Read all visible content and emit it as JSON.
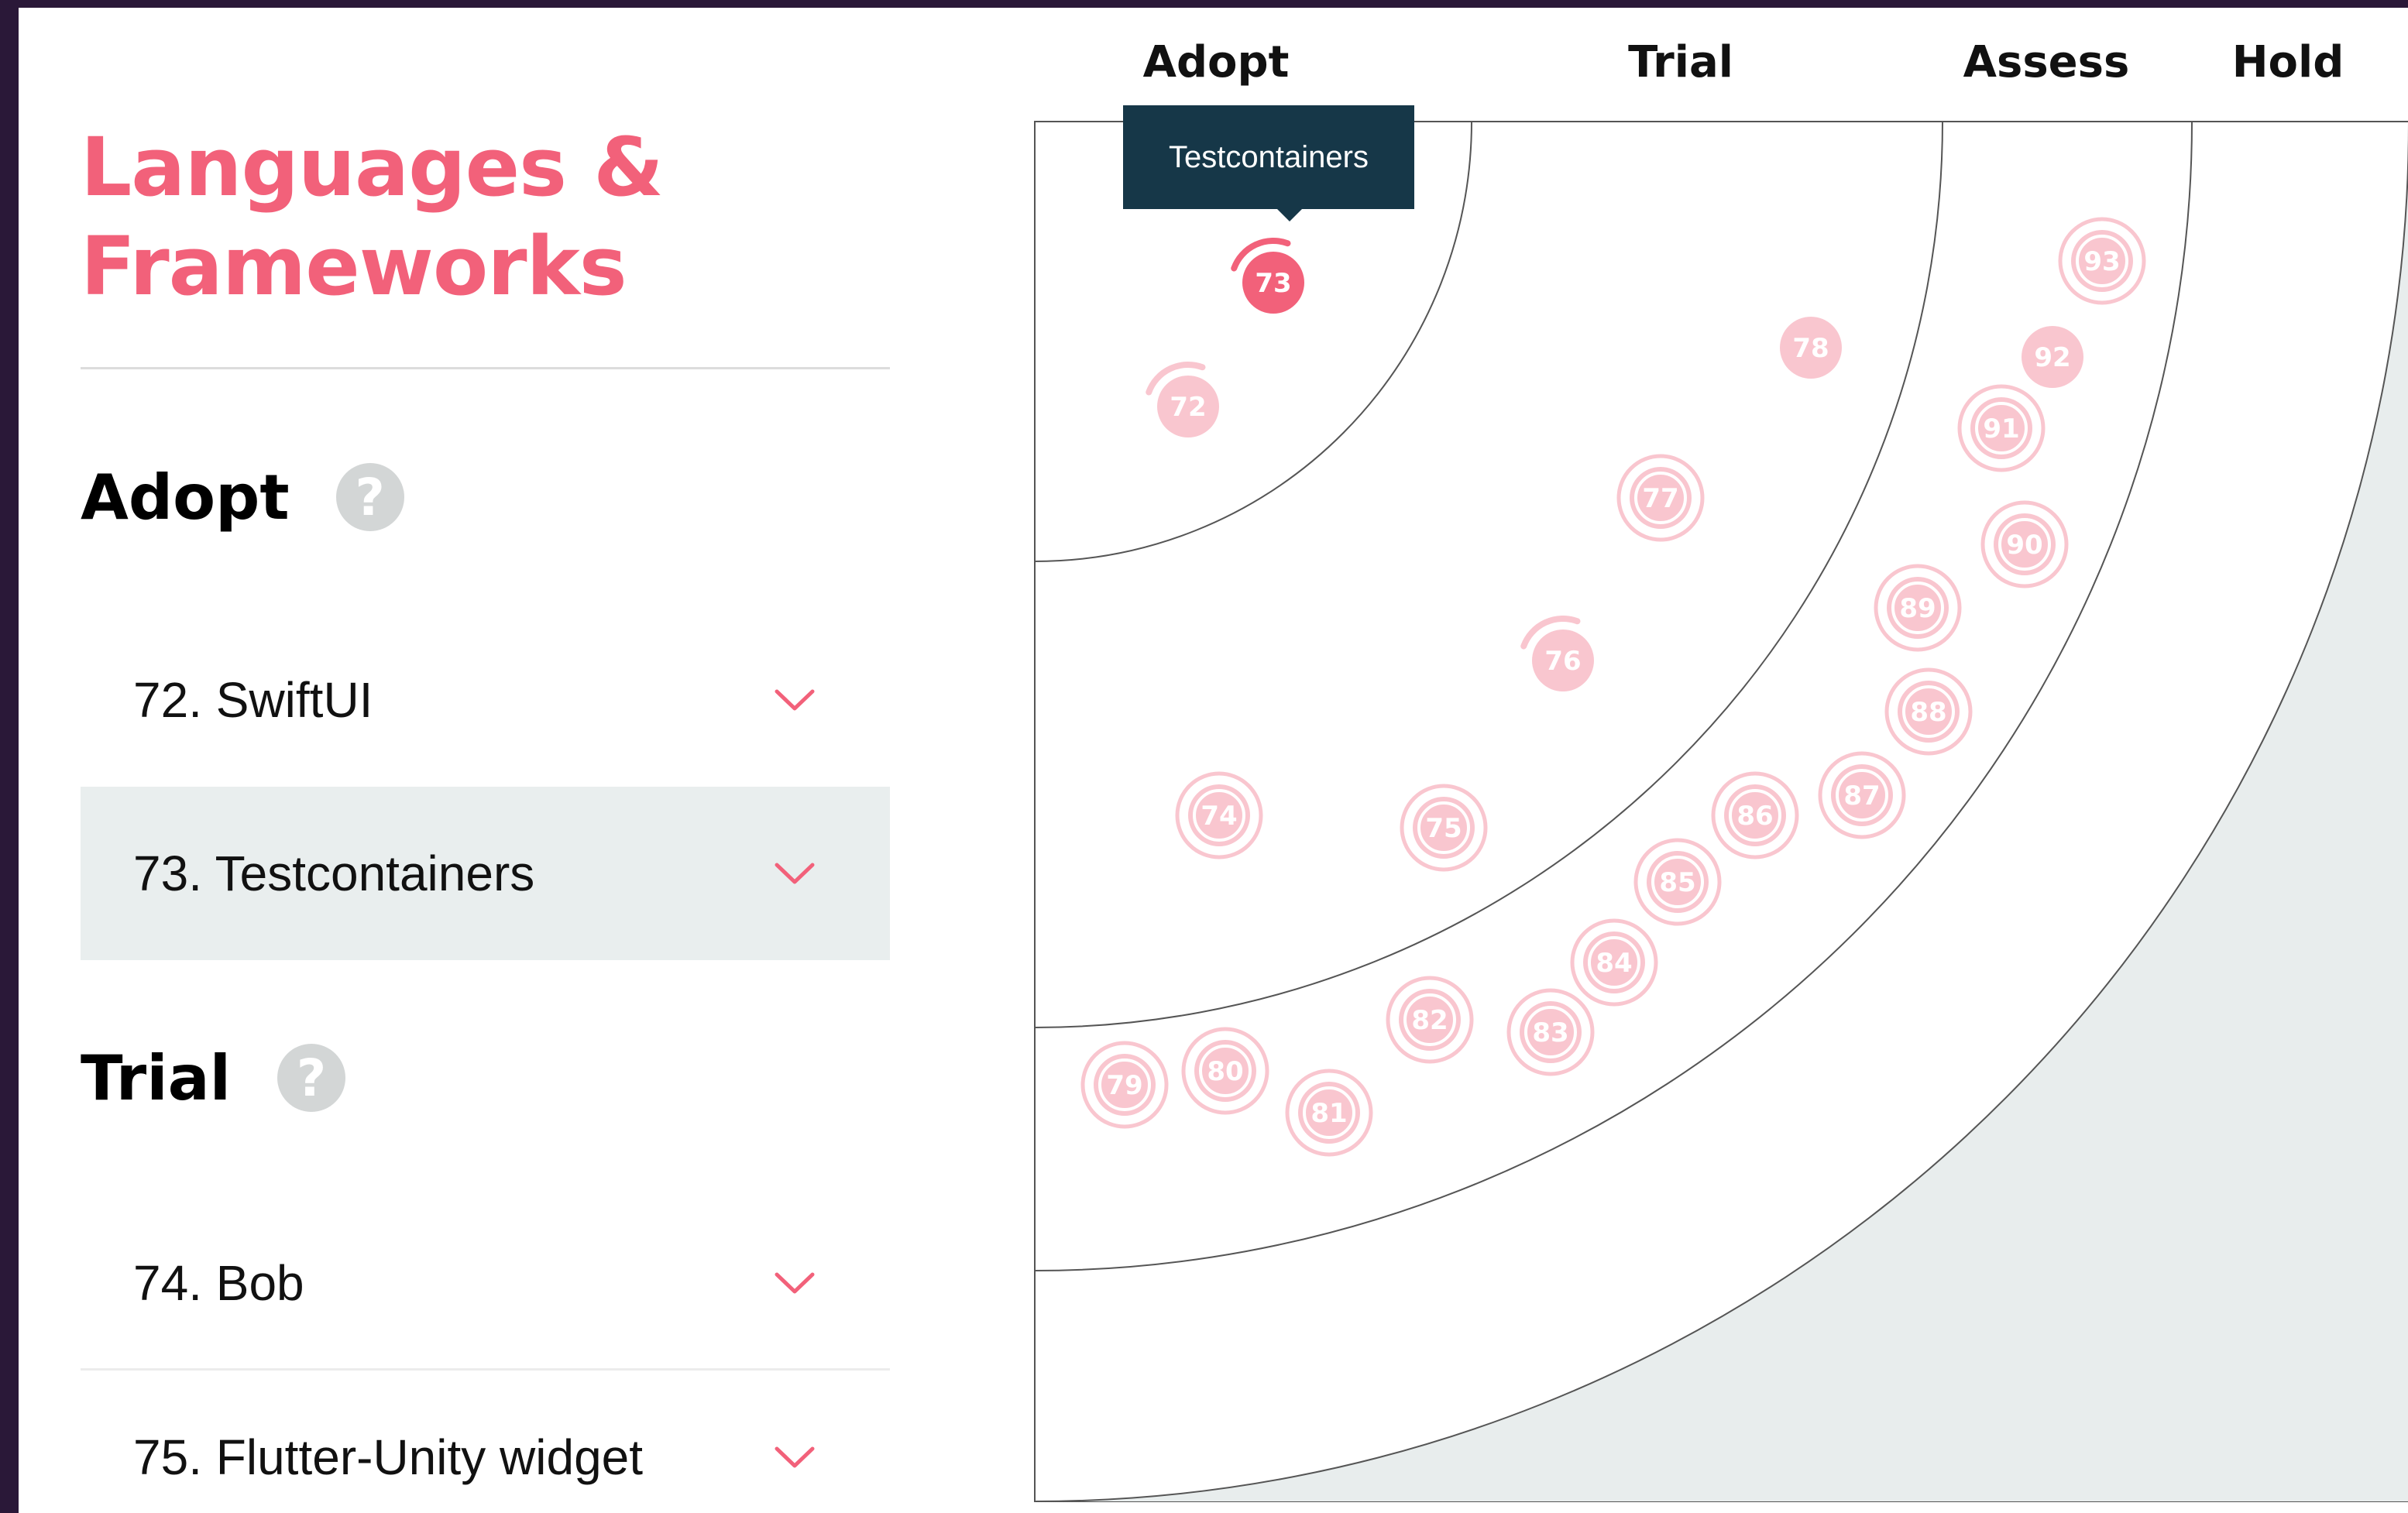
{
  "quadrant": {
    "title": "Languages &\nFrameworks"
  },
  "rings": [
    "Adopt",
    "Trial",
    "Assess",
    "Hold"
  ],
  "list": {
    "headings": [
      {
        "label": "Adopt",
        "help_icon": "question-mark-icon"
      },
      {
        "label": "Trial",
        "help_icon": "question-mark-icon"
      }
    ],
    "items": [
      {
        "label": "72. SwiftUI",
        "ring": "Adopt",
        "selected": false
      },
      {
        "label": "73. Testcontainers",
        "ring": "Adopt",
        "selected": true
      },
      {
        "label": "74. Bob",
        "ring": "Trial",
        "selected": false
      },
      {
        "label": "75. Flutter-Unity widget",
        "ring": "Trial",
        "selected": false
      }
    ],
    "expand_icon": "chevron-down-icon"
  },
  "tooltip": {
    "text": "Testcontainers"
  },
  "blips": [
    {
      "id": "72",
      "ring": "Adopt",
      "style": "new",
      "active": false
    },
    {
      "id": "73",
      "ring": "Adopt",
      "style": "new",
      "active": true
    },
    {
      "id": "74",
      "ring": "Trial",
      "style": "unchanged",
      "active": false
    },
    {
      "id": "75",
      "ring": "Trial",
      "style": "unchanged",
      "active": false
    },
    {
      "id": "76",
      "ring": "Trial",
      "style": "new",
      "active": false
    },
    {
      "id": "77",
      "ring": "Trial",
      "style": "unchanged",
      "active": false
    },
    {
      "id": "78",
      "ring": "Trial",
      "style": "plain",
      "active": false
    },
    {
      "id": "79",
      "ring": "Assess",
      "style": "unchanged",
      "active": false
    },
    {
      "id": "80",
      "ring": "Assess",
      "style": "unchanged",
      "active": false
    },
    {
      "id": "81",
      "ring": "Assess",
      "style": "unchanged",
      "active": false
    },
    {
      "id": "82",
      "ring": "Assess",
      "style": "unchanged",
      "active": false
    },
    {
      "id": "83",
      "ring": "Assess",
      "style": "unchanged",
      "active": false
    },
    {
      "id": "84",
      "ring": "Assess",
      "style": "unchanged",
      "active": false
    },
    {
      "id": "85",
      "ring": "Assess",
      "style": "unchanged",
      "active": false
    },
    {
      "id": "86",
      "ring": "Assess",
      "style": "unchanged",
      "active": false
    },
    {
      "id": "87",
      "ring": "Assess",
      "style": "unchanged",
      "active": false
    },
    {
      "id": "88",
      "ring": "Assess",
      "style": "unchanged",
      "active": false
    },
    {
      "id": "89",
      "ring": "Assess",
      "style": "unchanged",
      "active": false
    },
    {
      "id": "90",
      "ring": "Assess",
      "style": "unchanged",
      "active": false
    },
    {
      "id": "91",
      "ring": "Assess",
      "style": "unchanged",
      "active": false
    },
    {
      "id": "92",
      "ring": "Assess",
      "style": "plain",
      "active": false
    },
    {
      "id": "93",
      "ring": "Assess",
      "style": "unchanged",
      "active": false
    }
  ],
  "colors": {
    "accent": "#f2617a",
    "blip_faded": "#f9c6cf",
    "tooltip_bg": "#163748",
    "hold_fill": "#e8eded",
    "panel_selected": "#e9eeee",
    "frame": "#2a1838"
  }
}
